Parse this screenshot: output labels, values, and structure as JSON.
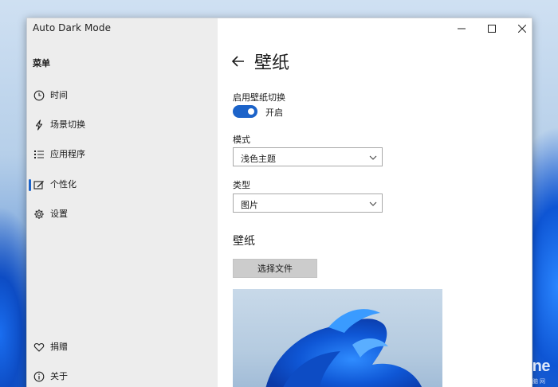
{
  "window": {
    "title": "Auto Dark Mode"
  },
  "sidebar": {
    "heading": "菜单",
    "items": [
      {
        "label": "时间",
        "icon": "clock-icon"
      },
      {
        "label": "场景切换",
        "icon": "lightning-icon"
      },
      {
        "label": "应用程序",
        "icon": "list-icon"
      },
      {
        "label": "个性化",
        "icon": "personalize-icon",
        "active": true
      },
      {
        "label": "设置",
        "icon": "gear-icon"
      }
    ],
    "footer_items": [
      {
        "label": "捐赠",
        "icon": "heart-icon"
      },
      {
        "label": "关于",
        "icon": "info-icon"
      }
    ]
  },
  "page": {
    "title": "壁纸",
    "wallpaper_switch": {
      "label": "启用壁纸切换",
      "state_text": "开启",
      "on": true
    },
    "mode": {
      "label": "模式",
      "value": "浅色主题"
    },
    "type": {
      "label": "类型",
      "value": "图片"
    },
    "section_title": "壁纸",
    "choose_file_label": "选择文件"
  },
  "watermark": {
    "brand": "PConline",
    "sub": "太平洋电脑网"
  },
  "colors": {
    "accent": "#1c63c9",
    "sidebar_bg": "#ededed",
    "button_bg": "#cccccc"
  }
}
